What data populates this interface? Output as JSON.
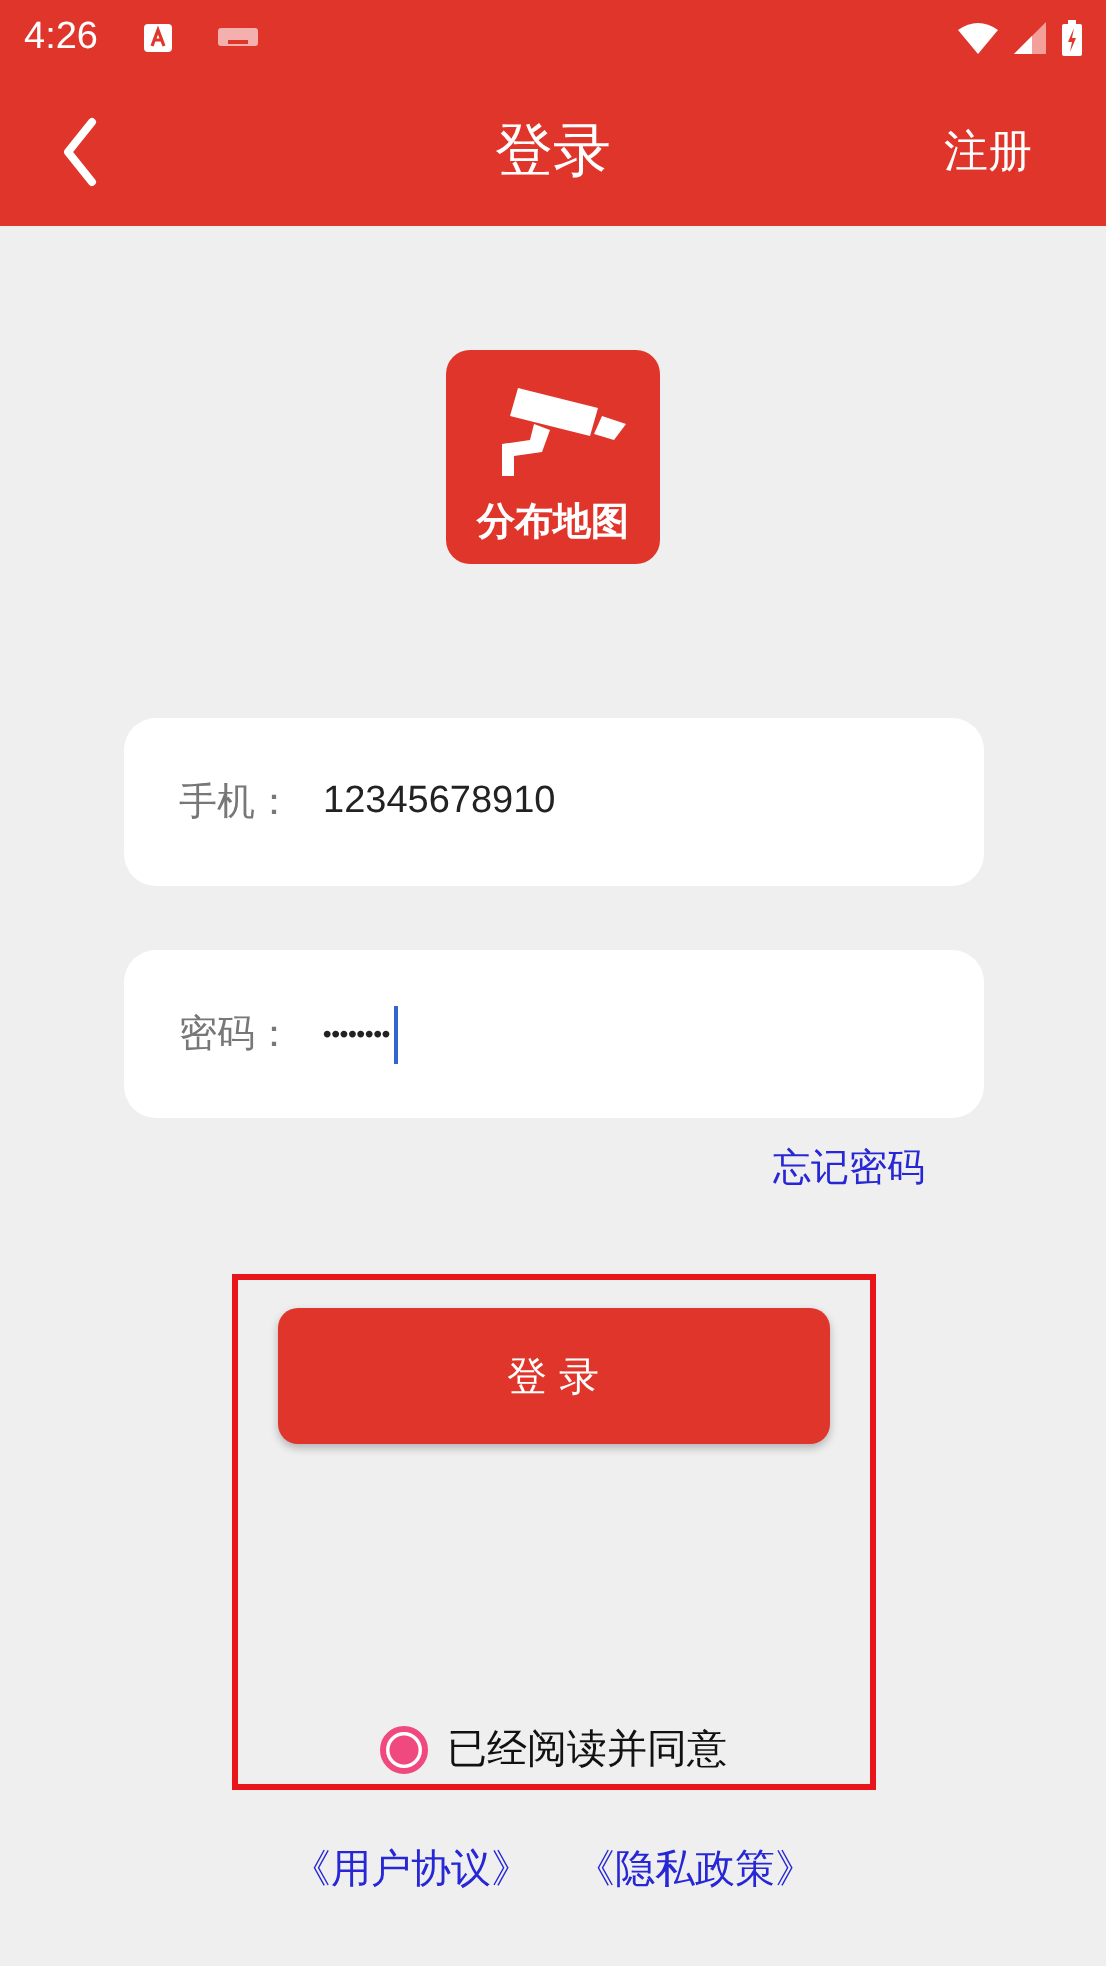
{
  "status_bar": {
    "time": "4:26"
  },
  "app_bar": {
    "title": "登录",
    "action": "注册"
  },
  "logo": {
    "text": "分布地图"
  },
  "fields": [
    {
      "label": "手机：",
      "value": "12345678910",
      "kind": "text",
      "focused": false
    },
    {
      "label": "密码：",
      "value": "••••••••",
      "kind": "password",
      "focused": true
    }
  ],
  "forgot_link": "忘记密码",
  "highlight_frame": true,
  "login_button": "登 录",
  "agreement": {
    "label": "已经阅读并同意",
    "checked": true
  },
  "links": [
    "《用户协议》",
    "《隐私政策》"
  ]
}
